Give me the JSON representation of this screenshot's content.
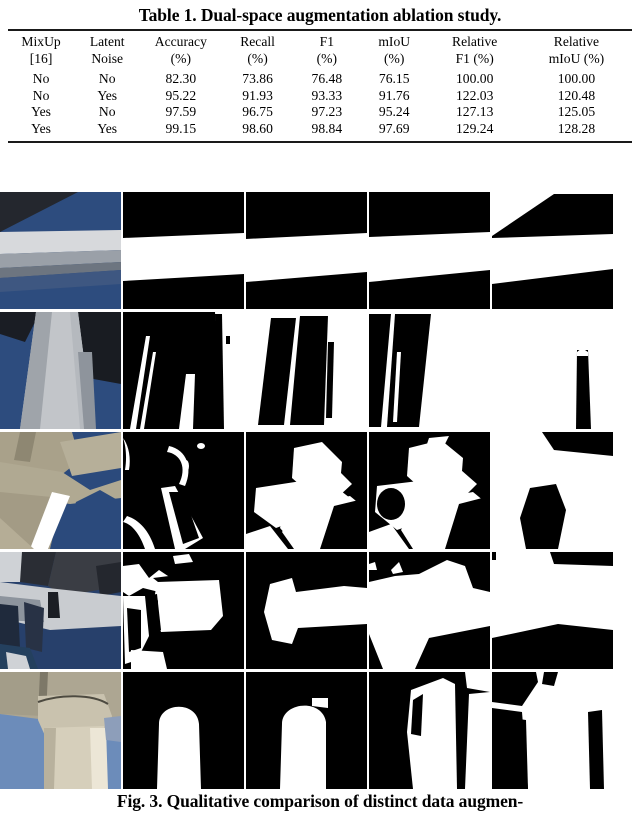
{
  "table": {
    "caption": "Table 1. Dual-space augmentation ablation study.",
    "columns": [
      {
        "line1": "MixUp",
        "line2": "[16]"
      },
      {
        "line1": "Latent",
        "line2": "Noise"
      },
      {
        "line1": "Accuracy",
        "line2": "(%)"
      },
      {
        "line1": "Recall",
        "line2": "(%)"
      },
      {
        "line1": "F1",
        "line2": "(%)"
      },
      {
        "line1": "mIoU",
        "line2": "(%)"
      },
      {
        "line1": "Relative",
        "line2": "F1 (%)"
      },
      {
        "line1": "Relative",
        "line2": "mIoU (%)"
      }
    ],
    "rows": [
      {
        "bold": false,
        "cells": [
          "No",
          "No",
          "82.30",
          "73.86",
          "76.48",
          "76.15",
          "100.00",
          "100.00"
        ]
      },
      {
        "bold": false,
        "cells": [
          "No",
          "Yes",
          "95.22",
          "91.93",
          "93.33",
          "91.76",
          "122.03",
          "120.48"
        ]
      },
      {
        "bold": false,
        "cells": [
          "Yes",
          "No",
          "97.59",
          "96.75",
          "97.23",
          "95.24",
          "127.13",
          "125.05"
        ]
      },
      {
        "bold": true,
        "cells": [
          "Yes",
          "Yes",
          "99.15",
          "98.60",
          "98.84",
          "97.69",
          "129.24",
          "128.28"
        ]
      }
    ]
  },
  "figure": {
    "caption": "Fig. 3. Qualitative comparison of distinct data augmen-",
    "columns": 5,
    "rows": 5,
    "row_labels": [
      "turbine-blade-horizontal",
      "turbine-tower",
      "turbine-nacelle-hub",
      "turbine-hub-closeup",
      "turbine-tower-junction"
    ],
    "column_kinds": [
      "input-photo",
      "mask-a",
      "mask-b",
      "mask-c",
      "mask-d"
    ]
  },
  "colors": {
    "sky_blue": "#2d4c7e",
    "sky_blue_light": "#6e8fbe",
    "blade_gray": "#c9ccd0",
    "nacelle_beige": "#b3ab94",
    "dark_shadow": "#1c1f26",
    "mask_fg": "#ffffff",
    "mask_bg": "#000000",
    "rule": "#1a1a1a"
  }
}
